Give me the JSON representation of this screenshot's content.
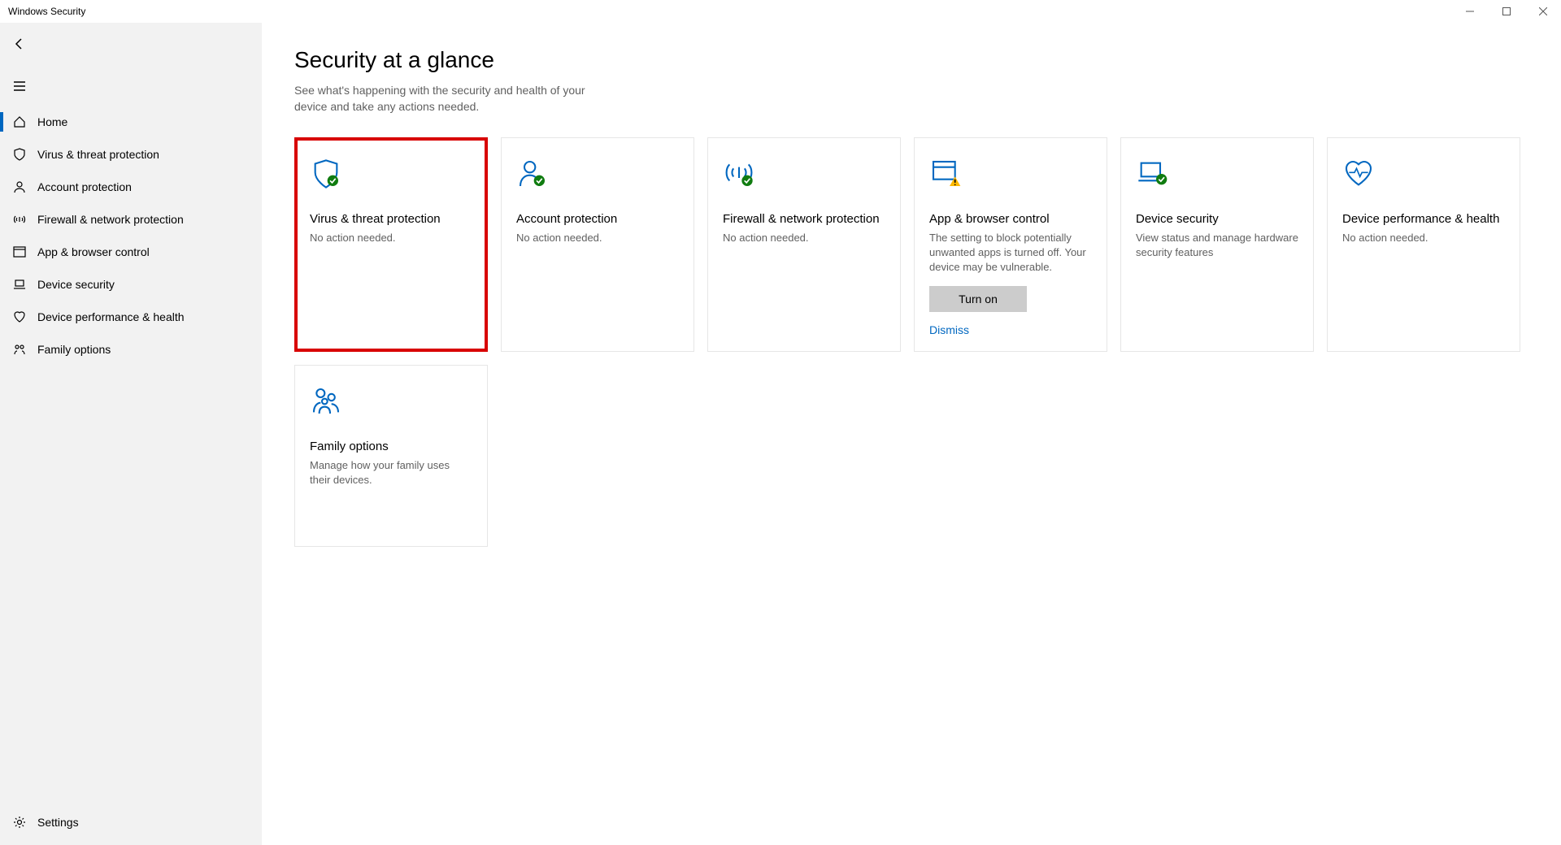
{
  "window": {
    "title": "Windows Security"
  },
  "sidebar": {
    "items": [
      {
        "label": "Home"
      },
      {
        "label": "Virus & threat protection"
      },
      {
        "label": "Account protection"
      },
      {
        "label": "Firewall & network protection"
      },
      {
        "label": "App & browser control"
      },
      {
        "label": "Device security"
      },
      {
        "label": "Device performance & health"
      },
      {
        "label": "Family options"
      }
    ],
    "settings_label": "Settings"
  },
  "page": {
    "title": "Security at a glance",
    "subtitle": "See what's happening with the security and health of your device and take any actions needed."
  },
  "tiles": [
    {
      "title": "Virus & threat protection",
      "desc": "No action needed."
    },
    {
      "title": "Account protection",
      "desc": "No action needed."
    },
    {
      "title": "Firewall & network protection",
      "desc": "No action needed."
    },
    {
      "title": "App & browser control",
      "desc": "The setting to block potentially unwanted apps is turned off. Your device may be vulnerable.",
      "button": "Turn on",
      "link": "Dismiss"
    },
    {
      "title": "Device security",
      "desc": "View status and manage hardware security features"
    },
    {
      "title": "Device performance & health",
      "desc": "No action needed."
    },
    {
      "title": "Family options",
      "desc": "Manage how your family uses their devices."
    }
  ]
}
